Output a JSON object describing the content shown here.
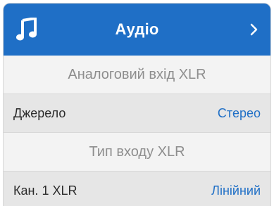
{
  "header": {
    "icon": "music-note-icon",
    "title": "Аудіо",
    "chevron": "chevron-right-icon"
  },
  "sections": [
    {
      "title": "Аналоговий вхід XLR"
    },
    {
      "title": "Тип входу XLR"
    }
  ],
  "rows": [
    {
      "label": "Джерело",
      "value": "Стерео"
    },
    {
      "label": "Кан. 1 XLR",
      "value": "Лінійний"
    }
  ],
  "colors": {
    "accent": "#1f6fc6",
    "header_bg": "#1f6fc6",
    "row_bg": "#e6e6e6",
    "section_text": "#8e8e8e"
  }
}
